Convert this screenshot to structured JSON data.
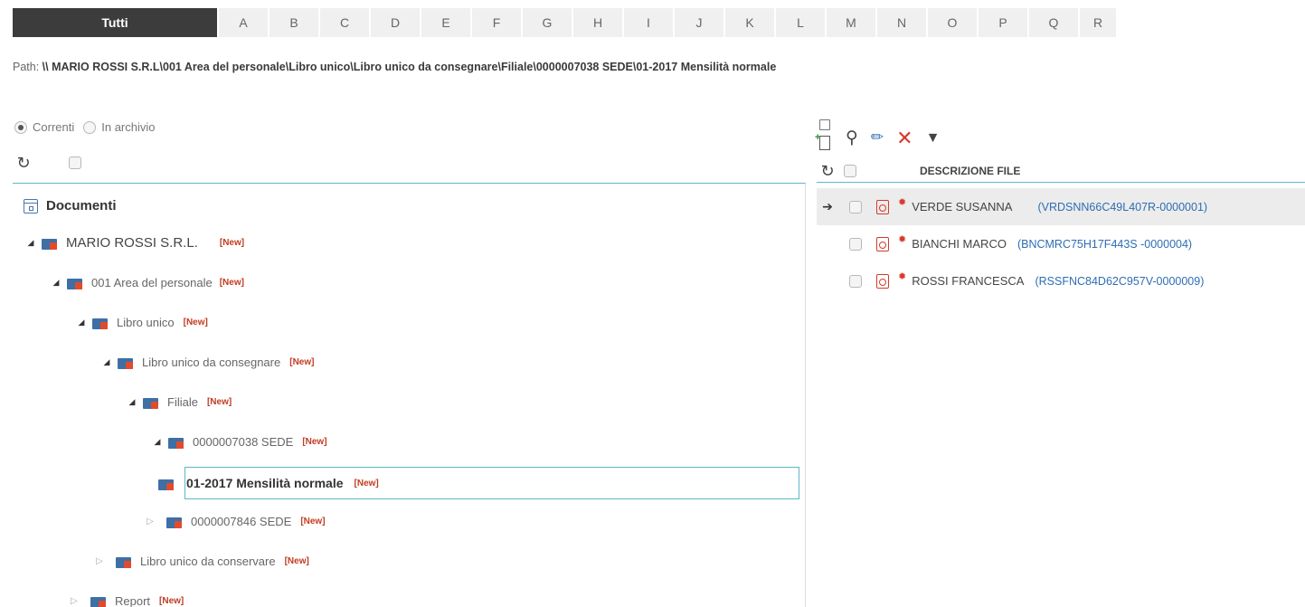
{
  "alphabet": {
    "tabs": [
      "Tutti",
      "A",
      "B",
      "C",
      "D",
      "E",
      "F",
      "G",
      "H",
      "I",
      "J",
      "K",
      "L",
      "M",
      "N",
      "O",
      "P",
      "Q",
      "R"
    ],
    "active": "Tutti"
  },
  "path": {
    "label": "Path:",
    "value": "\\\\ MARIO ROSSI S.R.L\\001 Area del personale\\Libro unico\\Libro unico da consegnare\\Filiale\\0000007038 SEDE\\01-2017 Mensilità normale"
  },
  "view_mode": {
    "options": [
      {
        "label": "Correnti",
        "checked": true
      },
      {
        "label": "In archivio",
        "checked": false
      }
    ]
  },
  "icons": {
    "refresh": "refresh-icon",
    "search": "search-icon",
    "edit": "pencil-icon",
    "delete": "delete-icon",
    "filter": "filter-icon",
    "new_file": "new-file-icon",
    "folder": "locked-folder-icon",
    "pdf": "pdf-icon",
    "gear": "gear-icon"
  },
  "tree": {
    "root": "Documenti",
    "new_badge": "[New]",
    "nodes": [
      {
        "label": "MARIO ROSSI S.R.L.",
        "expanded": true
      },
      {
        "label": "001 Area del personale",
        "expanded": true
      },
      {
        "label": "Libro unico",
        "expanded": true
      },
      {
        "label": "Libro unico da consegnare",
        "expanded": true
      },
      {
        "label": "Filiale",
        "expanded": true
      },
      {
        "label": "0000007038 SEDE",
        "expanded": true
      },
      {
        "label": "01-2017 Mensilità normale",
        "selected": true
      },
      {
        "label": "0000007846 SEDE",
        "expanded": false
      },
      {
        "label": "Libro unico da conservare",
        "expanded": false
      },
      {
        "label": "Report",
        "expanded": false
      }
    ]
  },
  "files": {
    "column_header": "DESCRIZIONE FILE",
    "rows": [
      {
        "name": "VERDE SUSANNA",
        "code": "(VRDSNN66C49L407R-0000001)",
        "current": true
      },
      {
        "name": "BIANCHI MARCO",
        "code": "(BNCMRC75H17F443S -0000004)"
      },
      {
        "name": "ROSSI FRANCESCA",
        "code": "(RSSFNC84D62C957V-0000009)"
      }
    ]
  },
  "colors": {
    "accent": "#5bb8c9",
    "active_tab": "#3c3c3c",
    "new_badge": "#c23b22",
    "link_code": "#2e6db4",
    "delete": "#d9382b"
  }
}
